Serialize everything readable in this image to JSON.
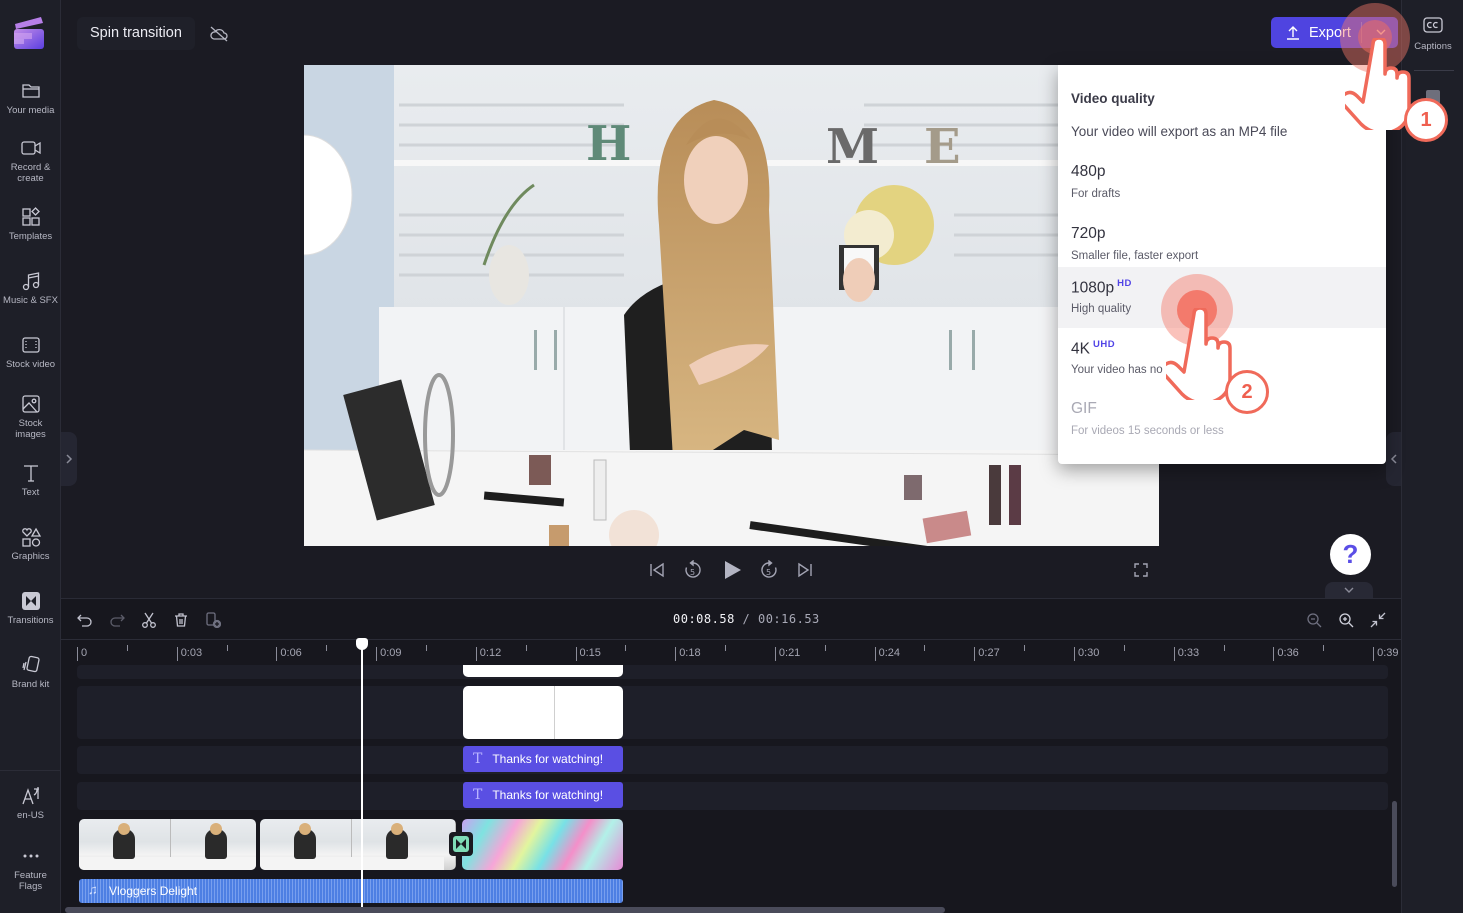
{
  "app": {
    "project_title": "Spin transition",
    "brand_colors": {
      "accent": "#4f44e0",
      "tutorial": "#f06a5a",
      "text_clip": "#5a4fe3",
      "audio_clip": "#4d7fe3"
    }
  },
  "sidebar": {
    "items": [
      {
        "label": "Your media",
        "icon": "folder-icon"
      },
      {
        "label": "Record & create",
        "icon": "camera-icon"
      },
      {
        "label": "Templates",
        "icon": "templates-icon"
      },
      {
        "label": "Music & SFX",
        "icon": "music-icon"
      },
      {
        "label": "Stock video",
        "icon": "film-icon"
      },
      {
        "label": "Stock images",
        "icon": "image-icon"
      },
      {
        "label": "Text",
        "icon": "text-icon"
      },
      {
        "label": "Graphics",
        "icon": "shapes-icon"
      },
      {
        "label": "Transitions",
        "icon": "transition-icon"
      },
      {
        "label": "Brand kit",
        "icon": "brand-kit-icon"
      }
    ],
    "bottom_items": [
      {
        "label": "en-US",
        "icon": "language-icon"
      },
      {
        "label": "Feature Flags",
        "icon": "more-icon"
      }
    ]
  },
  "topbar": {
    "export_label": "Export"
  },
  "right_rail": {
    "captions_label": "Captions"
  },
  "export_menu": {
    "title": "Video quality",
    "subtitle": "Your video will export as an MP4 file",
    "options": [
      {
        "name": "480p",
        "badge": "",
        "description": "For drafts",
        "highlighted": false,
        "disabled": false
      },
      {
        "name": "720p",
        "badge": "",
        "description": "Smaller file, faster export",
        "highlighted": false,
        "disabled": false
      },
      {
        "name": "1080p",
        "badge": "HD",
        "description": "High quality",
        "highlighted": true,
        "disabled": false
      },
      {
        "name": "4K",
        "badge": "UHD",
        "description": "Your video has no 4K media",
        "highlighted": false,
        "disabled": false
      },
      {
        "name": "GIF",
        "badge": "",
        "description": "For videos 15 seconds or less",
        "highlighted": false,
        "disabled": true
      }
    ]
  },
  "tutorial": {
    "steps": [
      "1",
      "2"
    ]
  },
  "help": {
    "label": "?"
  },
  "timeline": {
    "current_time": "00:08.58",
    "total_time": "/ 00:16.53",
    "ruler_labels": [
      "0",
      "0:03",
      "0:06",
      "0:09",
      "0:12",
      "0:15",
      "0:18",
      "0:21",
      "0:24",
      "0:27",
      "0:30",
      "0:33",
      "0:36",
      "0:39"
    ],
    "text_clips": [
      "Thanks for watching!",
      "Thanks for watching!"
    ],
    "audio_clip": "Vloggers Delight"
  }
}
